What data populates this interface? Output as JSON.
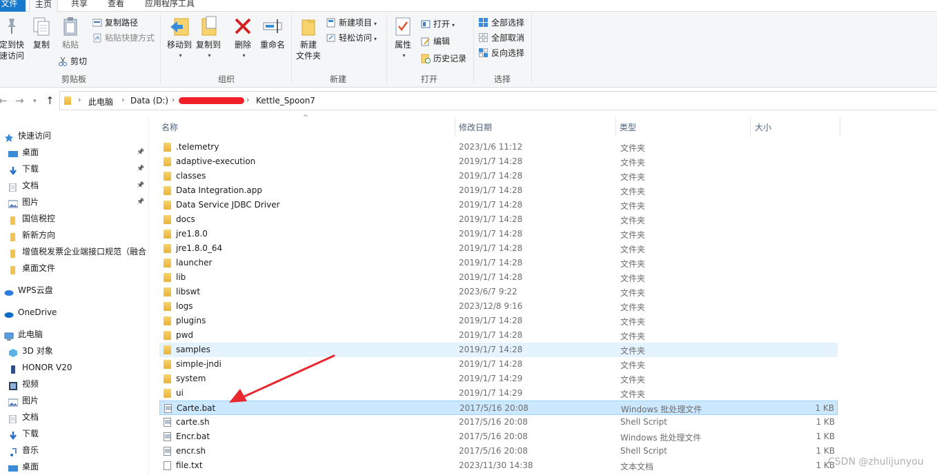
{
  "ribbon": {
    "tabs": [
      "文件",
      "主页",
      "共享",
      "查看",
      "应用程序工具"
    ],
    "clipboard": {
      "pin_label": "固定到快速访问",
      "pin_line1": "定到快",
      "pin_line2": "速访问",
      "copy": "复制",
      "paste": "粘贴",
      "copy_path": "复制路径",
      "paste_shortcut": "粘贴快捷方式",
      "cut": "剪切",
      "group": "剪贴板"
    },
    "organize": {
      "move_to": "移动到",
      "copy_to": "复制到",
      "delete": "删除",
      "rename": "重命名",
      "group": "组织"
    },
    "new": {
      "new_folder_line1": "新建",
      "new_folder_line2": "文件夹",
      "new_item": "新建项目",
      "easy_access": "轻松访问",
      "group": "新建"
    },
    "open": {
      "properties": "属性",
      "open": "打开",
      "edit": "编辑",
      "history": "历史记录",
      "group": "打开"
    },
    "select": {
      "select_all": "全部选择",
      "select_none": "全部取消",
      "invert": "反向选择",
      "group": "选择"
    }
  },
  "address": {
    "crumbs": [
      "此电脑",
      "Data (D:)",
      "Kettle_Spoon7"
    ]
  },
  "nav": {
    "quick_access": "快速访问",
    "items": [
      {
        "label": "桌面",
        "icon": "desktop-icon",
        "pinned": true
      },
      {
        "label": "下载",
        "icon": "download-icon",
        "pinned": true
      },
      {
        "label": "文档",
        "icon": "document-icon",
        "pinned": true
      },
      {
        "label": "图片",
        "icon": "picture-icon",
        "pinned": true
      },
      {
        "label": "国信税控",
        "icon": "folder-icon",
        "pinned": false
      },
      {
        "label": "新新方向",
        "icon": "folder-icon",
        "pinned": false
      },
      {
        "label": "增值税发票企业端接口规范（融合",
        "icon": "folder-icon",
        "pinned": false
      },
      {
        "label": "桌面文件",
        "icon": "folder-icon",
        "pinned": false
      }
    ],
    "wps": "WPS云盘",
    "onedrive": "OneDrive",
    "this_pc": "此电脑",
    "pc_items": [
      {
        "label": "3D 对象",
        "icon": "3d-objects-icon"
      },
      {
        "label": "HONOR V20",
        "icon": "phone-icon"
      },
      {
        "label": "视频",
        "icon": "video-icon"
      },
      {
        "label": "图片",
        "icon": "picture-icon"
      },
      {
        "label": "文档",
        "icon": "document-icon"
      },
      {
        "label": "下载",
        "icon": "download-icon"
      },
      {
        "label": "音乐",
        "icon": "music-icon"
      },
      {
        "label": "桌面",
        "icon": "desktop-icon"
      }
    ]
  },
  "columns": {
    "name": "名称",
    "date": "修改日期",
    "type": "类型",
    "size": "大小"
  },
  "files": [
    {
      "name": ".telemetry",
      "date": "2023/1/6 11:12",
      "type": "文件夹",
      "size": "",
      "kind": "folder"
    },
    {
      "name": "adaptive-execution",
      "date": "2019/1/7 14:28",
      "type": "文件夹",
      "size": "",
      "kind": "folder"
    },
    {
      "name": "classes",
      "date": "2019/1/7 14:28",
      "type": "文件夹",
      "size": "",
      "kind": "folder"
    },
    {
      "name": "Data Integration.app",
      "date": "2019/1/7 14:28",
      "type": "文件夹",
      "size": "",
      "kind": "folder"
    },
    {
      "name": "Data Service JDBC Driver",
      "date": "2019/1/7 14:28",
      "type": "文件夹",
      "size": "",
      "kind": "folder"
    },
    {
      "name": "docs",
      "date": "2019/1/7 14:28",
      "type": "文件夹",
      "size": "",
      "kind": "folder"
    },
    {
      "name": "jre1.8.0",
      "date": "2019/1/7 14:28",
      "type": "文件夹",
      "size": "",
      "kind": "folder"
    },
    {
      "name": "jre1.8.0_64",
      "date": "2019/1/7 14:28",
      "type": "文件夹",
      "size": "",
      "kind": "folder"
    },
    {
      "name": "launcher",
      "date": "2019/1/7 14:28",
      "type": "文件夹",
      "size": "",
      "kind": "folder"
    },
    {
      "name": "lib",
      "date": "2019/1/7 14:28",
      "type": "文件夹",
      "size": "",
      "kind": "folder"
    },
    {
      "name": "libswt",
      "date": "2023/6/7 9:22",
      "type": "文件夹",
      "size": "",
      "kind": "folder"
    },
    {
      "name": "logs",
      "date": "2023/12/8 9:16",
      "type": "文件夹",
      "size": "",
      "kind": "folder"
    },
    {
      "name": "plugins",
      "date": "2019/1/7 14:28",
      "type": "文件夹",
      "size": "",
      "kind": "folder"
    },
    {
      "name": "pwd",
      "date": "2019/1/7 14:28",
      "type": "文件夹",
      "size": "",
      "kind": "folder"
    },
    {
      "name": "samples",
      "date": "2019/1/7 14:28",
      "type": "文件夹",
      "size": "",
      "kind": "folder",
      "state": "hover"
    },
    {
      "name": "simple-jndi",
      "date": "2019/1/7 14:28",
      "type": "文件夹",
      "size": "",
      "kind": "folder"
    },
    {
      "name": "system",
      "date": "2019/1/7 14:29",
      "type": "文件夹",
      "size": "",
      "kind": "folder"
    },
    {
      "name": "ui",
      "date": "2019/1/7 14:29",
      "type": "文件夹",
      "size": "",
      "kind": "folder"
    },
    {
      "name": "Carte.bat",
      "date": "2017/5/16 20:08",
      "type": "Windows 批处理文件",
      "size": "1 KB",
      "kind": "script",
      "state": "selected"
    },
    {
      "name": "carte.sh",
      "date": "2017/5/16 20:08",
      "type": "Shell Script",
      "size": "1 KB",
      "kind": "script"
    },
    {
      "name": "Encr.bat",
      "date": "2017/5/16 20:08",
      "type": "Windows 批处理文件",
      "size": "1 KB",
      "kind": "script"
    },
    {
      "name": "encr.sh",
      "date": "2017/5/16 20:08",
      "type": "Shell Script",
      "size": "1 KB",
      "kind": "script"
    },
    {
      "name": "file.txt",
      "date": "2023/11/30 14:38",
      "type": "文本文档",
      "size": "1 KB",
      "kind": "text"
    }
  ],
  "watermark": "CSDN @zhulijunyou",
  "colors": {
    "accent": "#1979ca",
    "selected": "#cce8ff",
    "hover": "#e5f3ff",
    "arrow": "#e8272e"
  }
}
